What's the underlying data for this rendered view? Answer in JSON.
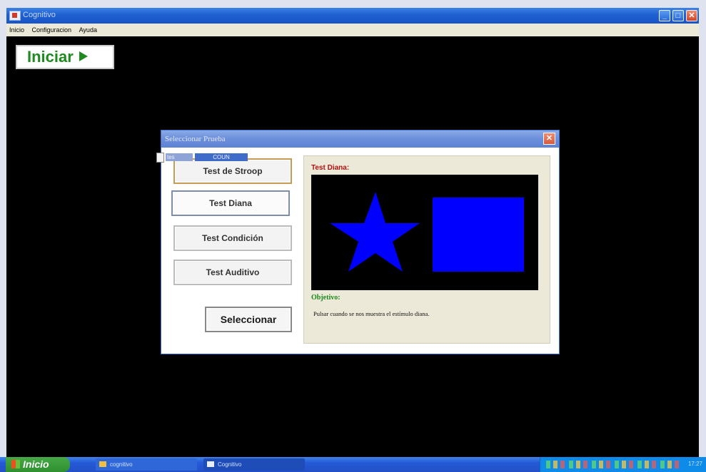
{
  "window": {
    "title": "Cognitivo",
    "controls": {
      "minimize": "_",
      "maximize": "□",
      "close": "✕"
    }
  },
  "menu": [
    "Inicio",
    "Configuracion",
    "Ayuda"
  ],
  "iniciar_label": "Iniciar",
  "dialog": {
    "title": "Seleccionar Prueba",
    "close": "✕",
    "drag_overlay": {
      "label1": "tes",
      "label2": "COUN"
    },
    "tests": [
      "Test de Stroop",
      "Test Diana",
      "Test Condición",
      "Test Auditivo"
    ],
    "select_label": "Seleccionar",
    "panel": {
      "title": "Test Diana:",
      "objective_label": "Objetivo:",
      "objective_text": "Pulsar cuando se nos muestra el estímulo diana.",
      "shape_color": "#0000ff"
    }
  },
  "taskbar": {
    "start_label": "Inicio",
    "tasks": [
      "cognitivo",
      "Cognitivo"
    ],
    "clock": "17:27"
  },
  "colors": {
    "titlebar": "#1e5fd0",
    "iniciar_text": "#1f8a1f",
    "panel_title": "#b01010",
    "objective_label": "#1a8a1a"
  }
}
